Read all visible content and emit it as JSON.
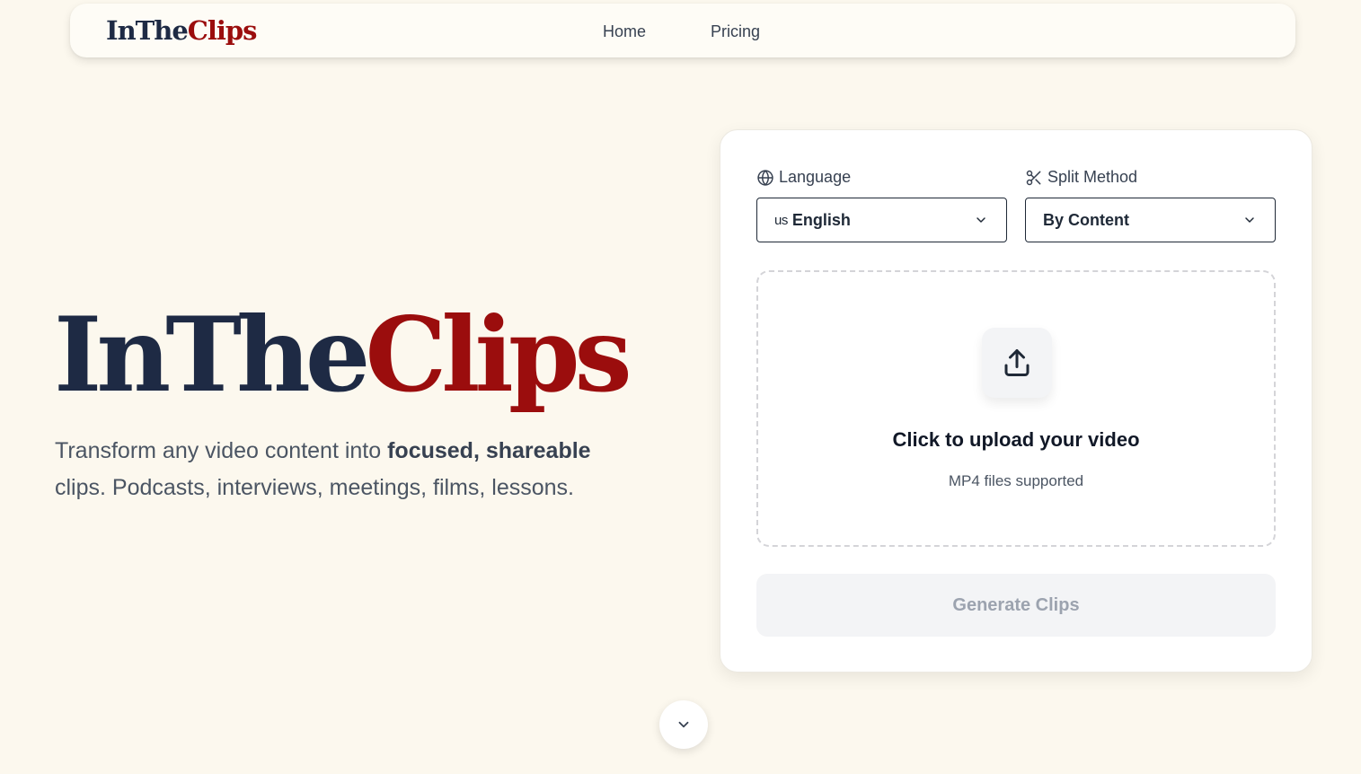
{
  "nav": {
    "brand_part1": "InThe",
    "brand_part2": "Clips",
    "links": [
      "Home",
      "Pricing"
    ]
  },
  "hero": {
    "title_part1": "InThe",
    "title_part2": "Clips",
    "subtitle_start": "Transform any video content into ",
    "subtitle_bold": "focused, shareable",
    "subtitle_end": " clips. Podcasts, interviews, meetings, films, lessons."
  },
  "form": {
    "language_label": "Language",
    "language_flag": "us",
    "language_value": "English",
    "split_label": "Split Method",
    "split_value": "By Content",
    "upload_title": "Click to upload your video",
    "upload_hint": "MP4 files supported",
    "generate_label": "Generate Clips"
  },
  "icons": {
    "language": "globe-icon",
    "split": "scissors-icon",
    "upload": "upload-icon",
    "dropdown": "chevron-down-icon",
    "scroll": "chevron-down-icon"
  },
  "colors": {
    "background": "#fcf8ee",
    "brand_dark": "#1e2a44",
    "brand_red": "#9b0d0d",
    "button_disabled_bg": "#f3f4f6",
    "button_disabled_text": "#9ca3af"
  }
}
